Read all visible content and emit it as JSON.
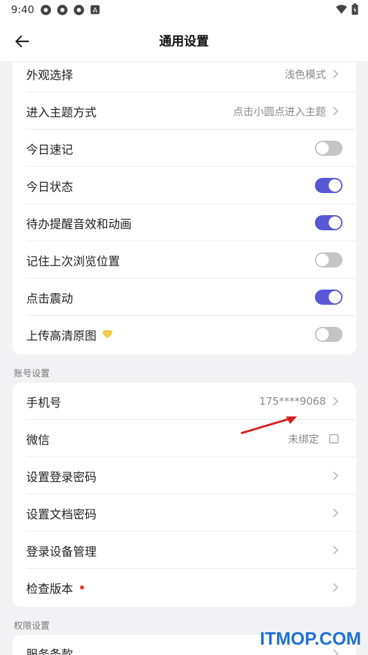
{
  "status_bar": {
    "time": "9:40",
    "icons": [
      "app-icon",
      "app-icon",
      "app-icon",
      "notification-a-icon"
    ],
    "right_icons": [
      "wifi-icon",
      "battery-icon"
    ]
  },
  "header": {
    "title": "通用设置",
    "back_icon": "arrow-left-icon"
  },
  "general_settings": [
    {
      "label": "外观选择",
      "type": "value",
      "value": "浅色模式"
    },
    {
      "label": "进入主题方式",
      "type": "value",
      "value": "点击小圆点进入主题"
    },
    {
      "label": "今日速记",
      "type": "toggle",
      "on": false
    },
    {
      "label": "今日状态",
      "type": "toggle",
      "on": true
    },
    {
      "label": "待办提醒音效和动画",
      "type": "toggle",
      "on": true
    },
    {
      "label": "记住上次浏览位置",
      "type": "toggle",
      "on": false
    },
    {
      "label": "点击震动",
      "type": "toggle",
      "on": true
    },
    {
      "label": "上传高清原图",
      "type": "toggle",
      "on": false,
      "badge_icon": "diamond-icon"
    }
  ],
  "account_section": {
    "title": "账号设置",
    "items": [
      {
        "label": "手机号",
        "type": "value",
        "value": "175****9068"
      },
      {
        "label": "微信",
        "type": "checkbox",
        "value": "未绑定"
      },
      {
        "label": "设置登录密码",
        "type": "link"
      },
      {
        "label": "设置文档密码",
        "type": "link"
      },
      {
        "label": "登录设备管理",
        "type": "link"
      },
      {
        "label": "检查版本",
        "type": "link",
        "dot": true
      }
    ]
  },
  "permission_section": {
    "title": "权限设置",
    "items": [
      {
        "label": "服务条款",
        "type": "link"
      }
    ]
  },
  "watermark": "ITMOP.COM",
  "colors": {
    "accent": "#5a57d6",
    "toggle_off": "#c4c4c8",
    "background": "#f2f2f5",
    "red_dot": "#ec3b2a",
    "watermark": "#1d70d8",
    "arrow": "#d91f1f"
  }
}
